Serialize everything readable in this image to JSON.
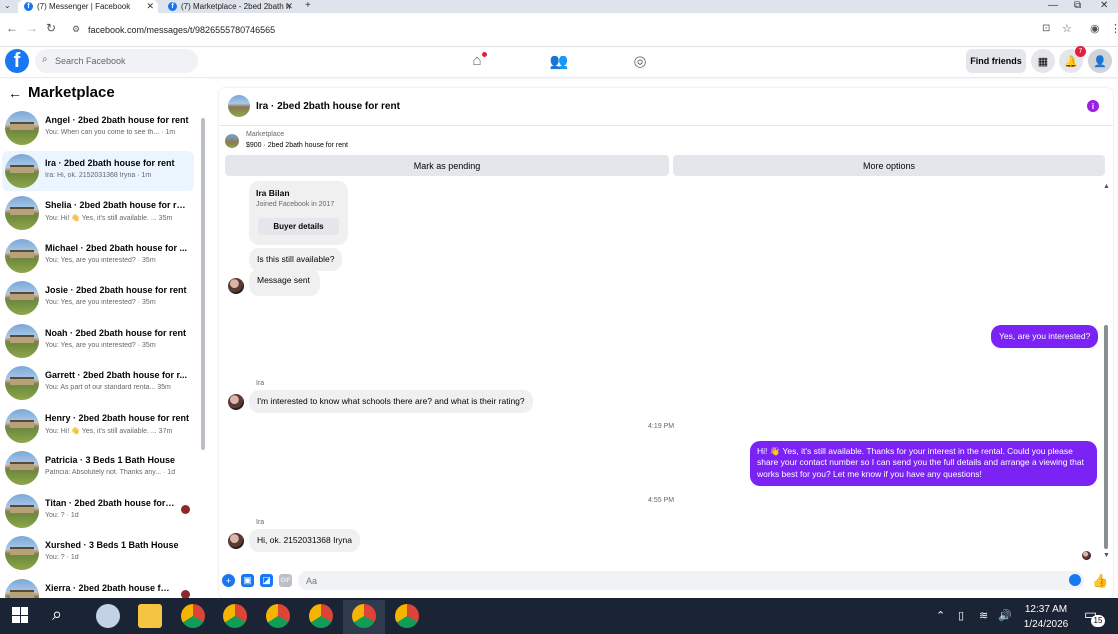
{
  "browser": {
    "tabs": [
      {
        "label": "(7) Messenger | Facebook"
      },
      {
        "label": "(7) Marketplace - 2bed 2bath h"
      }
    ],
    "url": "facebook.com/messages/t/9826555780746565"
  },
  "header": {
    "search_placeholder": "Search Facebook",
    "find_friends": "Find friends",
    "notification_count": "7"
  },
  "sidebar": {
    "title": "Marketplace",
    "conversations": [
      {
        "name": "Angel · 2bed 2bath house for rent",
        "preview": "You: When can you come to see th... · 1m"
      },
      {
        "name": "Ira · 2bed 2bath house for rent",
        "preview": "Ira: Hi, ok. 2152031368 Iryna · 1m"
      },
      {
        "name": "Shelia · 2bed 2bath house for rent",
        "preview": "You: Hi! 👋 Yes, it's still available. ... 35m"
      },
      {
        "name": "Michael · 2bed 2bath house for ...",
        "preview": "You: Yes, are you interested? · 35m"
      },
      {
        "name": "Josie · 2bed 2bath house for rent",
        "preview": "You: Yes, are you interested? · 35m"
      },
      {
        "name": "Noah · 2bed 2bath house for rent",
        "preview": "You: Yes, are you interested? · 35m"
      },
      {
        "name": "Garrett · 2bed 2bath house for r...",
        "preview": "You: As part of our standard renta... 35m"
      },
      {
        "name": "Henry · 2bed 2bath house for rent",
        "preview": "You: Hi! 👋 Yes, it's still available. ... 37m"
      },
      {
        "name": "Patricia · 3 Beds 1 Bath House",
        "preview": "Patricia: Absolutely not. Thanks any... · 1d"
      },
      {
        "name": "Titan · 2bed 2bath house for r...",
        "preview": "You: ? · 1d"
      },
      {
        "name": "Xurshed · 3 Beds 1 Bath House",
        "preview": "You: ? · 1d"
      },
      {
        "name": "Xierra · 2bed 2bath house for ...",
        "preview": ""
      }
    ]
  },
  "chat": {
    "title": "Ira · 2bed 2bath house for rent",
    "marketplace_label": "Marketplace",
    "listing": "$900 · 2bed 2bath house for rent",
    "mark_pending": "Mark as pending",
    "more_options": "More options",
    "buyer_name": "Ira Bilan",
    "buyer_joined": "Joined Facebook in 2017",
    "buyer_details": "Buyer details",
    "msg_still_available": "Is this still available?",
    "msg_sent": "Message sent",
    "msg_out_interested": "Yes, are you interested?",
    "sender_ira": "Ira",
    "msg_schools": "I'm interested to know what schools there are? and what is their rating?",
    "time_1": "4:19 PM",
    "msg_out_long": "Hi! 👋 Yes, it's still available. Thanks for your interest in the rental. Could you please share your contact number so I can send you the full details and arrange a viewing that works best for you? Let me know if you have any questions!",
    "time_2": "4:55 PM",
    "msg_number": "Hi, ok. 2152031368 Iryna",
    "composer_placeholder": "Aa"
  },
  "taskbar": {
    "time": "12:37 AM",
    "date": "1/24/2026",
    "notif_count": "15"
  }
}
